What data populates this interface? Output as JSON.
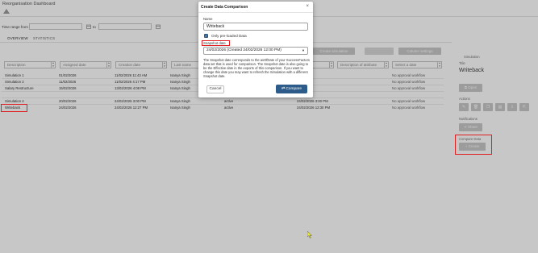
{
  "app": {
    "title": "Reorganisation Dashboard"
  },
  "filters": {
    "date_range_label": "Time range from",
    "to_label": "to",
    "from_value": "",
    "to_value": ""
  },
  "tabs": [
    {
      "label": "OVERVIEW"
    },
    {
      "label": "STATISTICS"
    }
  ],
  "toolbar": {
    "create_simulation": "Create simulation",
    "third_button": "",
    "column_settings": "Column settings"
  },
  "table": {
    "column_filters": [
      "Description",
      "Assigned date",
      "Creation date",
      "Last name",
      "",
      "Description of attribute",
      "Select a date"
    ],
    "rows": [
      {
        "name": "Simulation 1",
        "date": "01/02/2026",
        "created": "11/02/2026 11:43 AM",
        "owner": "Isanya Singh",
        "status": "",
        "updated": "",
        "note": "No approval workflow"
      },
      {
        "name": "Simulation 2",
        "date": "11/02/2026",
        "created": "11/02/2026 4:17 PM",
        "owner": "Isanya Singh",
        "status": "",
        "updated": "",
        "note": "No approval workflow"
      },
      {
        "name": "Salary Restructure",
        "date": "15/02/2026",
        "created": "13/02/2026 4:08 PM",
        "owner": "Isanya Singh",
        "status": "",
        "updated": "",
        "note": "No approval workflow"
      },
      {
        "name": "",
        "date": "",
        "created": "",
        "owner": "",
        "status": "",
        "updated": "",
        "note": ""
      },
      {
        "name": "Simulation 4",
        "date": "20/02/2026",
        "created": "24/02/2026 3:00 PM",
        "owner": "Isanya Singh",
        "status": "active",
        "updated": "24/02/2026 3:00 PM",
        "note": "No approval workflow"
      },
      {
        "name": "Writeback",
        "date": "24/02/2026",
        "created": "24/02/2026 12:27 PM",
        "owner": "Isanya Singh",
        "status": "active",
        "updated": "24/02/2026 12:30 PM",
        "note": "No approval workflow"
      }
    ]
  },
  "side_panel": {
    "simulation_label": "Simulation",
    "title_label": "Title",
    "title": "Writeback",
    "open_button": "Open",
    "actions_label": "Actions",
    "notifications_label": "Notifications",
    "share_button": "Share",
    "create_section_label": "Compare Data",
    "create_button": "Create"
  },
  "modal": {
    "title": "Create Data Comparison",
    "close": "×",
    "name_label": "Name",
    "name_value": "Writeback",
    "checkbox_label": "Only pre-loaded Data",
    "snapshot_label": "Snapshot date",
    "snapshot_value": "24/02/2026 (Created 24/02/2026 12:00 PM)",
    "description": "The Snapshot date corresponds to the asOfDate of your SuccessFactors data set that is used for comparison. The Snapshot date is also going to be the Effective date in the exports of this comparison. If you want to change this date you may want to refresh the Simulation with a different Snapshot date.",
    "cancel": "Cancel",
    "compare": "Compare"
  },
  "colors": {
    "primary": "#2e5c8a",
    "highlight": "#e02020",
    "muted_button": "#c8c8c8"
  },
  "icons": [
    "logo-icon",
    "calendar-icon",
    "sort-icon",
    "open-icon",
    "edit-icon",
    "delete-icon",
    "copy-icon",
    "upload-icon",
    "download-icon",
    "share-icon",
    "plus-icon",
    "compare-icon",
    "checkbox-icon",
    "cursor-icon"
  ]
}
